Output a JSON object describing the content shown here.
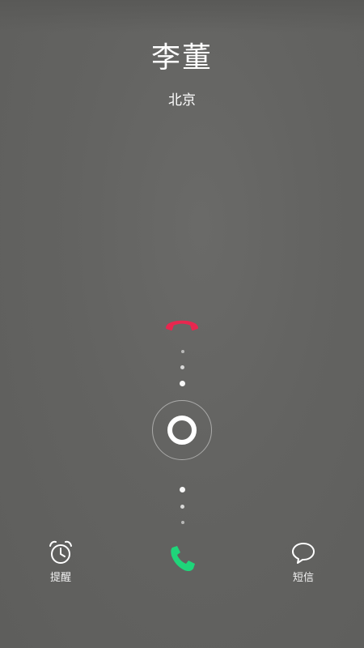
{
  "caller": {
    "name": "李董",
    "location": "北京"
  },
  "actions": {
    "remind_label": "提醒",
    "message_label": "短信"
  },
  "icons": {
    "decline": "phone-hangup-icon",
    "answer": "phone-answer-icon",
    "remind": "alarm-clock-icon",
    "message": "speech-bubble-icon"
  },
  "colors": {
    "background": "#626260",
    "decline": "#e8274f",
    "answer": "#1fd57a",
    "text": "#ffffff"
  }
}
